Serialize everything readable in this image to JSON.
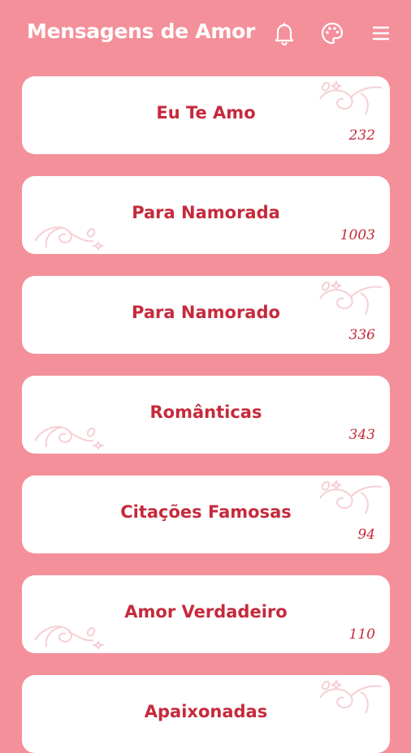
{
  "header": {
    "title": "Mensagens de Amor",
    "icons": [
      "bell-icon",
      "palette-icon",
      "menu-icon"
    ]
  },
  "colors": {
    "background": "#f4909a",
    "card": "#ffffff",
    "text_accent": "#c62a3c",
    "ornament": "#f6cfd4"
  },
  "categories": [
    {
      "label": "Eu Te Amo",
      "count": "232"
    },
    {
      "label": "Para Namorada",
      "count": "1003"
    },
    {
      "label": "Para Namorado",
      "count": "336"
    },
    {
      "label": "Românticas",
      "count": "343"
    },
    {
      "label": "Citações Famosas",
      "count": "94"
    },
    {
      "label": "Amor Verdadeiro",
      "count": "110"
    },
    {
      "label": "Apaixonadas",
      "count": ""
    }
  ]
}
